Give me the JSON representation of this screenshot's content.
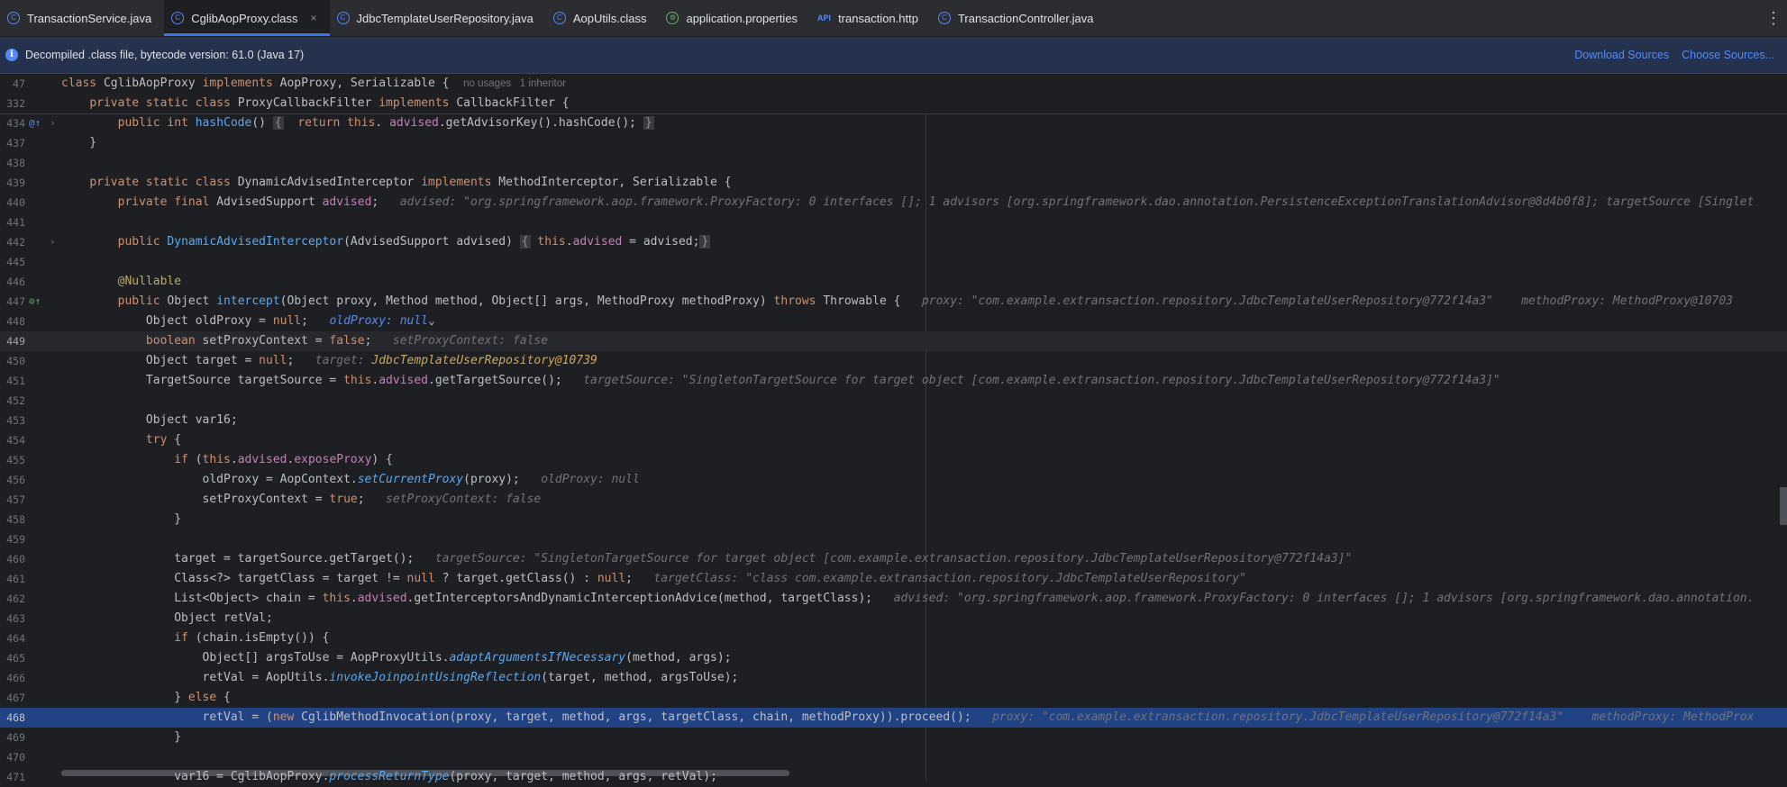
{
  "tabs": [
    {
      "label": "TransactionService.java",
      "icon": "class-icon",
      "glyph": "C",
      "active": false
    },
    {
      "label": "CglibAopProxy.class",
      "icon": "class-icon",
      "glyph": "C",
      "active": true
    },
    {
      "label": "JdbcTemplateUserRepository.java",
      "icon": "class-icon",
      "glyph": "C",
      "active": false
    },
    {
      "label": "AopUtils.class",
      "icon": "class-icon",
      "glyph": "C",
      "active": false
    },
    {
      "label": "application.properties",
      "icon": "properties-icon",
      "glyph": "⚙",
      "active": false
    },
    {
      "label": "transaction.http",
      "icon": "api-icon",
      "glyph": "API",
      "active": false
    },
    {
      "label": "TransactionController.java",
      "icon": "class-icon",
      "glyph": "C",
      "active": false
    }
  ],
  "tab_close_glyph": "×",
  "more_glyph": "⋮",
  "banner": {
    "info_glyph": "i",
    "text": "Decompiled .class file, bytecode version: 61.0 (Java 17)",
    "download_sources": "Download Sources",
    "choose_sources": "Choose Sources..."
  },
  "sticky_lines": [
    {
      "num": "47",
      "segments": [
        [
          "kw",
          "class "
        ],
        [
          "",
          "CglibAopProxy "
        ],
        [
          "kw",
          "implements "
        ],
        [
          "",
          "AopProxy, Serializable {  "
        ],
        [
          "meta",
          "no usages   1 inheritor"
        ]
      ]
    },
    {
      "num": "332",
      "segments": [
        [
          "",
          "    "
        ],
        [
          "kw",
          "private static class "
        ],
        [
          "",
          "ProxyCallbackFilter "
        ],
        [
          "kw",
          "implements "
        ],
        [
          "",
          "CallbackFilter {"
        ]
      ]
    }
  ],
  "lines": [
    {
      "num": "434",
      "mark": "@↑",
      "fold": "›",
      "segments": [
        [
          "",
          "        "
        ],
        [
          "kw",
          "public int "
        ],
        [
          "fn",
          "hashCode"
        ],
        [
          "",
          "() "
        ],
        [
          "foldbox",
          "{"
        ],
        [
          "",
          "  "
        ],
        [
          "kw",
          "return this"
        ],
        [
          "",
          ". "
        ],
        [
          "fd",
          "advised"
        ],
        [
          "",
          ".getAdvisorKey().hashCode(); "
        ],
        [
          "foldbox",
          "}"
        ]
      ]
    },
    {
      "num": "437",
      "segments": [
        [
          "",
          "    }"
        ]
      ]
    },
    {
      "num": "438",
      "segments": []
    },
    {
      "num": "439",
      "segments": [
        [
          "",
          "    "
        ],
        [
          "kw",
          "private static class "
        ],
        [
          "",
          "DynamicAdvisedInterceptor "
        ],
        [
          "kw",
          "implements "
        ],
        [
          "",
          "MethodInterceptor, Serializable {"
        ]
      ]
    },
    {
      "num": "440",
      "segments": [
        [
          "",
          "        "
        ],
        [
          "kw",
          "private final "
        ],
        [
          "",
          "AdvisedSupport "
        ],
        [
          "fd",
          "advised"
        ],
        [
          "",
          ";   "
        ],
        [
          "hint",
          "advised: \"org.springframework.aop.framework.ProxyFactory: 0 interfaces []; 1 advisors [org.springframework.dao.annotation.PersistenceExceptionTranslationAdvisor@8d4b0f8]; targetSource [Singlet"
        ]
      ]
    },
    {
      "num": "441",
      "segments": []
    },
    {
      "num": "442",
      "fold": "›",
      "segments": [
        [
          "",
          "        "
        ],
        [
          "kw",
          "public "
        ],
        [
          "fn",
          "DynamicAdvisedInterceptor"
        ],
        [
          "",
          "(AdvisedSupport advised) "
        ],
        [
          "foldbox",
          "{"
        ],
        [
          "",
          ""
        ],
        [
          "kw",
          " this"
        ],
        [
          "",
          "."
        ],
        [
          "fd",
          "advised"
        ],
        [
          "",
          " = advised;"
        ],
        [
          "foldbox",
          "}"
        ]
      ]
    },
    {
      "num": "445",
      "segments": []
    },
    {
      "num": "446",
      "segments": [
        [
          "",
          "        "
        ],
        [
          "an",
          "@Nullable"
        ]
      ]
    },
    {
      "num": "447",
      "mark": "⊙↑",
      "segments": [
        [
          "",
          "        "
        ],
        [
          "kw",
          "public "
        ],
        [
          "",
          "Object "
        ],
        [
          "fn",
          "intercept"
        ],
        [
          "",
          "(Object proxy, Method method, Object[] args, MethodProxy methodProxy) "
        ],
        [
          "kw",
          "throws "
        ],
        [
          "",
          "Throwable {   "
        ],
        [
          "hint",
          "proxy: \"com.example.extransaction.repository.JdbcTemplateUserRepository@772f14a3\"    methodProxy: MethodProxy@10703"
        ]
      ]
    },
    {
      "num": "448",
      "segments": [
        [
          "",
          "            Object oldProxy = "
        ],
        [
          "kw",
          "null"
        ],
        [
          "",
          ";   "
        ],
        [
          "hintb",
          "oldProxy: null"
        ],
        [
          "",
          "⌄"
        ]
      ]
    },
    {
      "num": "449",
      "cur": true,
      "segments": [
        [
          "",
          "            "
        ],
        [
          "kw",
          "boolean "
        ],
        [
          "",
          "setProxyContext = "
        ],
        [
          "kw",
          "false"
        ],
        [
          "",
          ";   "
        ],
        [
          "hint",
          "setProxyContext: false"
        ]
      ]
    },
    {
      "num": "450",
      "segments": [
        [
          "",
          "            Object target = "
        ],
        [
          "kw",
          "null"
        ],
        [
          "",
          ";   "
        ],
        [
          "hint",
          "target: "
        ],
        [
          "hinty",
          "JdbcTemplateUserRepository@10739"
        ]
      ]
    },
    {
      "num": "451",
      "segments": [
        [
          "",
          "            TargetSource targetSource = "
        ],
        [
          "kw",
          "this"
        ],
        [
          "",
          "."
        ],
        [
          "fd",
          "advised"
        ],
        [
          "",
          ".getTargetSource();   "
        ],
        [
          "hint",
          "targetSource: \"SingletonTargetSource for target object [com.example.extransaction.repository.JdbcTemplateUserRepository@772f14a3]\""
        ]
      ]
    },
    {
      "num": "452",
      "segments": []
    },
    {
      "num": "453",
      "segments": [
        [
          "",
          "            Object var16;"
        ]
      ]
    },
    {
      "num": "454",
      "segments": [
        [
          "",
          "            "
        ],
        [
          "kw",
          "try "
        ],
        [
          "",
          "{"
        ]
      ]
    },
    {
      "num": "455",
      "segments": [
        [
          "",
          "                "
        ],
        [
          "kw",
          "if "
        ],
        [
          "",
          "("
        ],
        [
          "kw",
          "this"
        ],
        [
          "",
          "."
        ],
        [
          "fd",
          "advised"
        ],
        [
          "",
          "."
        ],
        [
          "fd",
          "exposeProxy"
        ],
        [
          "",
          ") {"
        ]
      ]
    },
    {
      "num": "456",
      "segments": [
        [
          "",
          "                    oldProxy = AopContext."
        ],
        [
          "it",
          "setCurrentProxy"
        ],
        [
          "",
          "(proxy);   "
        ],
        [
          "hint",
          "oldProxy: null"
        ]
      ]
    },
    {
      "num": "457",
      "segments": [
        [
          "",
          "                    setProxyContext = "
        ],
        [
          "kw",
          "true"
        ],
        [
          "",
          ";   "
        ],
        [
          "hint",
          "setProxyContext: false"
        ]
      ]
    },
    {
      "num": "458",
      "segments": [
        [
          "",
          "                }"
        ]
      ]
    },
    {
      "num": "459",
      "segments": []
    },
    {
      "num": "460",
      "segments": [
        [
          "",
          "                target = targetSource.getTarget();   "
        ],
        [
          "hint",
          "targetSource: \"SingletonTargetSource for target object [com.example.extransaction.repository.JdbcTemplateUserRepository@772f14a3]\""
        ]
      ]
    },
    {
      "num": "461",
      "segments": [
        [
          "",
          "                Class<?> targetClass = target != "
        ],
        [
          "kw",
          "null "
        ],
        [
          "",
          "? target.getClass() : "
        ],
        [
          "kw",
          "null"
        ],
        [
          "",
          ";   "
        ],
        [
          "hint",
          "targetClass: \"class com.example.extransaction.repository.JdbcTemplateUserRepository\""
        ]
      ]
    },
    {
      "num": "462",
      "segments": [
        [
          "",
          "                List<Object> chain = "
        ],
        [
          "kw",
          "this"
        ],
        [
          "",
          "."
        ],
        [
          "fd",
          "advised"
        ],
        [
          "",
          ".getInterceptorsAndDynamicInterceptionAdvice(method, targetClass);   "
        ],
        [
          "hint",
          "advised: \"org.springframework.aop.framework.ProxyFactory: 0 interfaces []; 1 advisors [org.springframework.dao.annotation."
        ]
      ]
    },
    {
      "num": "463",
      "segments": [
        [
          "",
          "                Object retVal;"
        ]
      ]
    },
    {
      "num": "464",
      "segments": [
        [
          "",
          "                "
        ],
        [
          "kw",
          "if "
        ],
        [
          "",
          "(chain.isEmpty()) {"
        ]
      ]
    },
    {
      "num": "465",
      "segments": [
        [
          "",
          "                    Object[] argsToUse = AopProxyUtils."
        ],
        [
          "it",
          "adaptArgumentsIfNecessary"
        ],
        [
          "",
          "(method, args);"
        ]
      ]
    },
    {
      "num": "466",
      "segments": [
        [
          "",
          "                    retVal = AopUtils."
        ],
        [
          "it",
          "invokeJoinpointUsingReflection"
        ],
        [
          "",
          "(target, method, argsToUse);"
        ]
      ]
    },
    {
      "num": "467",
      "segments": [
        [
          "",
          "                } "
        ],
        [
          "kw",
          "else "
        ],
        [
          "",
          "{"
        ]
      ]
    },
    {
      "num": "468",
      "hl": true,
      "segments": [
        [
          "",
          "                    retVal = ("
        ],
        [
          "kw",
          "new "
        ],
        [
          "",
          "CglibMethodInvocation(proxy, target, method, args, targetClass, chain, methodProxy)).proceed();   "
        ],
        [
          "hint",
          "proxy: \"com.example.extransaction.repository.JdbcTemplateUserRepository@772f14a3\"    methodProxy: MethodProx"
        ]
      ]
    },
    {
      "num": "469",
      "segments": [
        [
          "",
          "                }"
        ]
      ]
    },
    {
      "num": "470",
      "segments": []
    },
    {
      "num": "471",
      "segments": [
        [
          "",
          "                var16 = CglibAopProxy."
        ],
        [
          "it",
          "processReturnType"
        ],
        [
          "",
          "(proxy, target, method, args, retVal);"
        ]
      ]
    }
  ]
}
